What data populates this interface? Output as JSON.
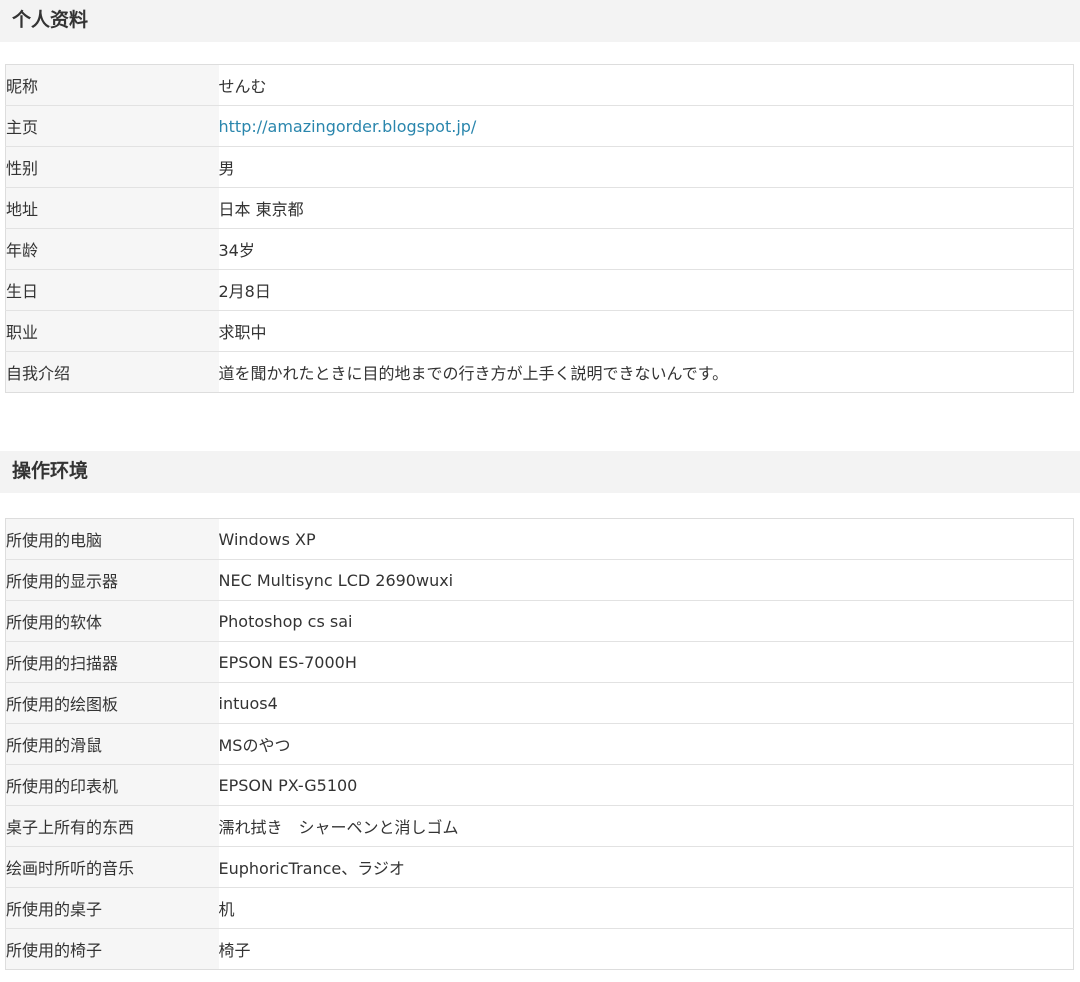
{
  "profile": {
    "title": "个人资料",
    "rows": [
      {
        "label": "昵称",
        "value": "せんむ"
      },
      {
        "label": "主页",
        "value": "http://amazingorder.blogspot.jp/"
      },
      {
        "label": "性别",
        "value": "男"
      },
      {
        "label": "地址",
        "value": "日本 東京都"
      },
      {
        "label": "年龄",
        "value": "34岁"
      },
      {
        "label": "生日",
        "value": "2月8日"
      },
      {
        "label": "职业",
        "value": "求职中"
      },
      {
        "label": "自我介绍",
        "value": "道を聞かれたときに目的地までの行き方が上手く説明できないんです。"
      }
    ]
  },
  "environment": {
    "title": "操作环境",
    "rows": [
      {
        "label": "所使用的电脑",
        "value": "Windows XP"
      },
      {
        "label": "所使用的显示器",
        "value": "NEC Multisync LCD 2690wuxi"
      },
      {
        "label": "所使用的软体",
        "value": "Photoshop cs sai"
      },
      {
        "label": "所使用的扫描器",
        "value": "EPSON ES-7000H"
      },
      {
        "label": "所使用的绘图板",
        "value": "intuos4"
      },
      {
        "label": "所使用的滑鼠",
        "value": "MSのやつ"
      },
      {
        "label": "所使用的印表机",
        "value": "EPSON PX-G5100"
      },
      {
        "label": "桌子上所有的东西",
        "value": "濡れ拭き　シャーペンと消しゴム"
      },
      {
        "label": "绘画时所听的音乐",
        "value": "EuphoricTrance、ラジオ"
      },
      {
        "label": "所使用的桌子",
        "value": "机"
      },
      {
        "label": "所使用的椅子",
        "value": "椅子"
      }
    ]
  },
  "colors": {
    "link": "#2a86ad",
    "header_bg": "#f3f3f3",
    "label_bg": "#f6f6f6"
  }
}
